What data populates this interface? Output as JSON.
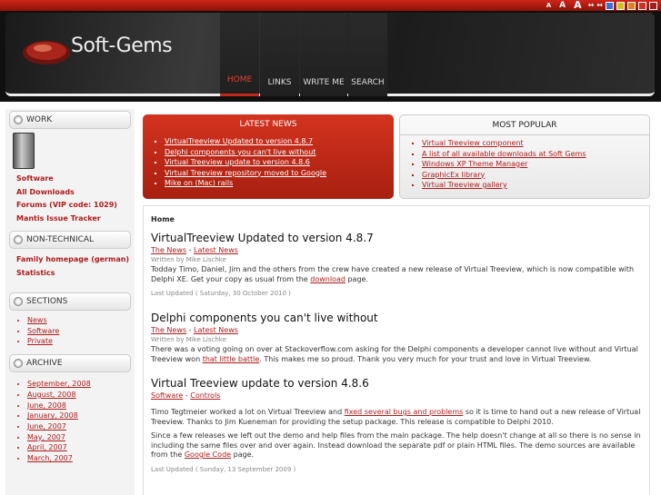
{
  "toolbar": {
    "font_small": "A",
    "font_medium": "A",
    "font_large": "A",
    "narrow": "↔",
    "wide": "↔",
    "swatches": [
      "#3a6fd8",
      "#d0c020",
      "#e08020",
      "#d03020",
      "#a02020"
    ]
  },
  "header": {
    "logo_text": "Soft-Gems",
    "nav": [
      "HOME",
      "LINKS",
      "WRITE ME",
      "SEARCH"
    ]
  },
  "sidebar": {
    "work": {
      "title": "WORK",
      "links": [
        "Software",
        "All Downloads",
        "Forums (VIP code: 1029)",
        "Mantis Issue Tracker"
      ]
    },
    "nontech": {
      "title": "NON-TECHNICAL",
      "links": [
        "Family homepage (german)",
        "Statistics"
      ]
    },
    "sections": {
      "title": "SECTIONS",
      "links": [
        "News",
        "Software",
        "Private"
      ]
    },
    "archive": {
      "title": "ARCHIVE",
      "links": [
        "September, 2008",
        "August, 2008",
        "June, 2008",
        "January, 2008",
        "June, 2007",
        "May, 2007",
        "April, 2007",
        "March, 2007"
      ]
    }
  },
  "latest": {
    "title": "LATEST NEWS",
    "items": [
      "VirtualTreeview Updated to version 4.8.7",
      "Delphi components you can't live without",
      "Virtual Treeview update to version 4.8.6",
      "Virtual Treeview repository moved to Google",
      "Mike on (Mac) rails"
    ]
  },
  "popular": {
    "title": "MOST POPULAR",
    "items": [
      "Virtual Treeview component",
      "A list of all available downloads at Soft Gems",
      "Windows XP Theme Manager",
      "GraphicEx library",
      "Virtual Treeview gallery"
    ]
  },
  "content": {
    "breadcrumb": "Home",
    "a1": {
      "title": "VirtualTreeview Updated to version 4.8.7",
      "cat1": "The News",
      "sep": " - ",
      "cat2": "Latest News",
      "author": "Written by Mike Lischke",
      "p1_a": "Todday Timo, Daniel, Jim and the others from the crew have created a new release of Virtual Treeview, which is now compatible with Delphi XE. Get your copy as usual from the ",
      "p1_link": "download",
      "p1_b": " page.",
      "updated": "Last Updated ( Saturday, 30 October 2010 )"
    },
    "a2": {
      "title": "Delphi components you can't live without",
      "cat1": "The News",
      "sep": " - ",
      "cat2": "Latest News",
      "author": "Written by Mike Lischke",
      "p1_a": "There was a voting going on over at Stackoverflow.com asking for the Delphi components a developer cannot live without and Virtual Treeview won ",
      "p1_link": "that little battle",
      "p1_b": ". This makes me so proud. Thank you very much for your trust and love in Virtual Treeview."
    },
    "a3": {
      "title": "Virtual Treeview update to version 4.8.6",
      "cat1": "Software",
      "sep": " - ",
      "cat2": "Controls",
      "p1_a": "Timo Tegtmeier worked a lot on Virtual Treeview and ",
      "p1_link": "fixed several bugs and problems",
      "p1_b": " so it is time to hand out a new release of Virtual Treeview. Thanks to Jim Kueneman for providing the setup package. This release is compatible to Delphi 2010.",
      "p2_a": "Since a few releases we left out the demo and help files from the main package. The help doesn't change at all so there is no sense in including the same files over and over again. Instead download the separate pdf or plain HTML files. The demo sources are available from the ",
      "p2_link": "Google Code",
      "p2_b": " page.",
      "updated": "Last Updated ( Sunday, 13 September 2009 )"
    }
  }
}
